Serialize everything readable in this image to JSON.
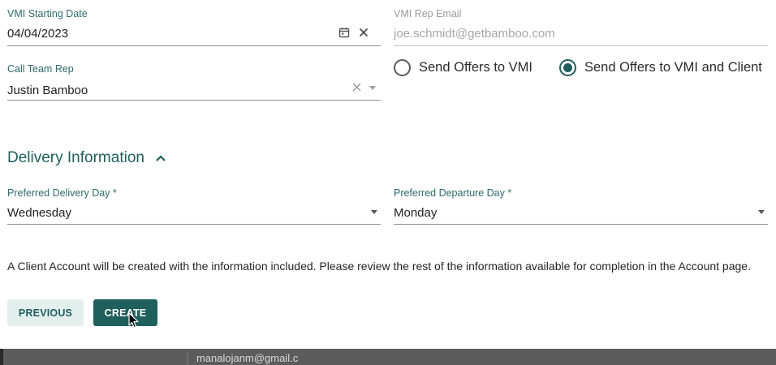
{
  "form": {
    "vmi_start_date": {
      "label": "VMI Starting Date",
      "value": "04/04/2023",
      "icon": "calendar-icon",
      "clear_icon": "close-icon"
    },
    "vmi_rep_email": {
      "label": "VMI Rep Email",
      "value": "joe.schmidt@getbamboo.com"
    },
    "call_team_rep": {
      "label": "Call Team Rep",
      "value": "Justin Bamboo",
      "clear_icon": "close-icon",
      "dropdown_icon": "dropdown-arrow-icon"
    },
    "send_offers": {
      "options": [
        {
          "label": "Send Offers to VMI",
          "selected": false
        },
        {
          "label": "Send Offers to VMI and Client",
          "selected": true
        }
      ]
    }
  },
  "delivery": {
    "title": "Delivery Information",
    "collapse_icon": "chevron-up-icon",
    "preferred_delivery_day": {
      "label": "Preferred Delivery Day *",
      "value": "Wednesday"
    },
    "preferred_departure_day": {
      "label": "Preferred Departure Day *",
      "value": "Monday"
    }
  },
  "info_message": "A Client Account will be created with the information included. Please review the rest of the information available for completion in the Account page.",
  "buttons": {
    "previous": "PREVIOUS",
    "create": "CREATE"
  },
  "background": {
    "visible_text": "manalojanm@gmail.c"
  },
  "colors": {
    "accent": "#1f5f5c",
    "label": "#2e6a6a",
    "secondary_button_bg": "#e3efed",
    "backdrop": "#5c5c5c"
  }
}
